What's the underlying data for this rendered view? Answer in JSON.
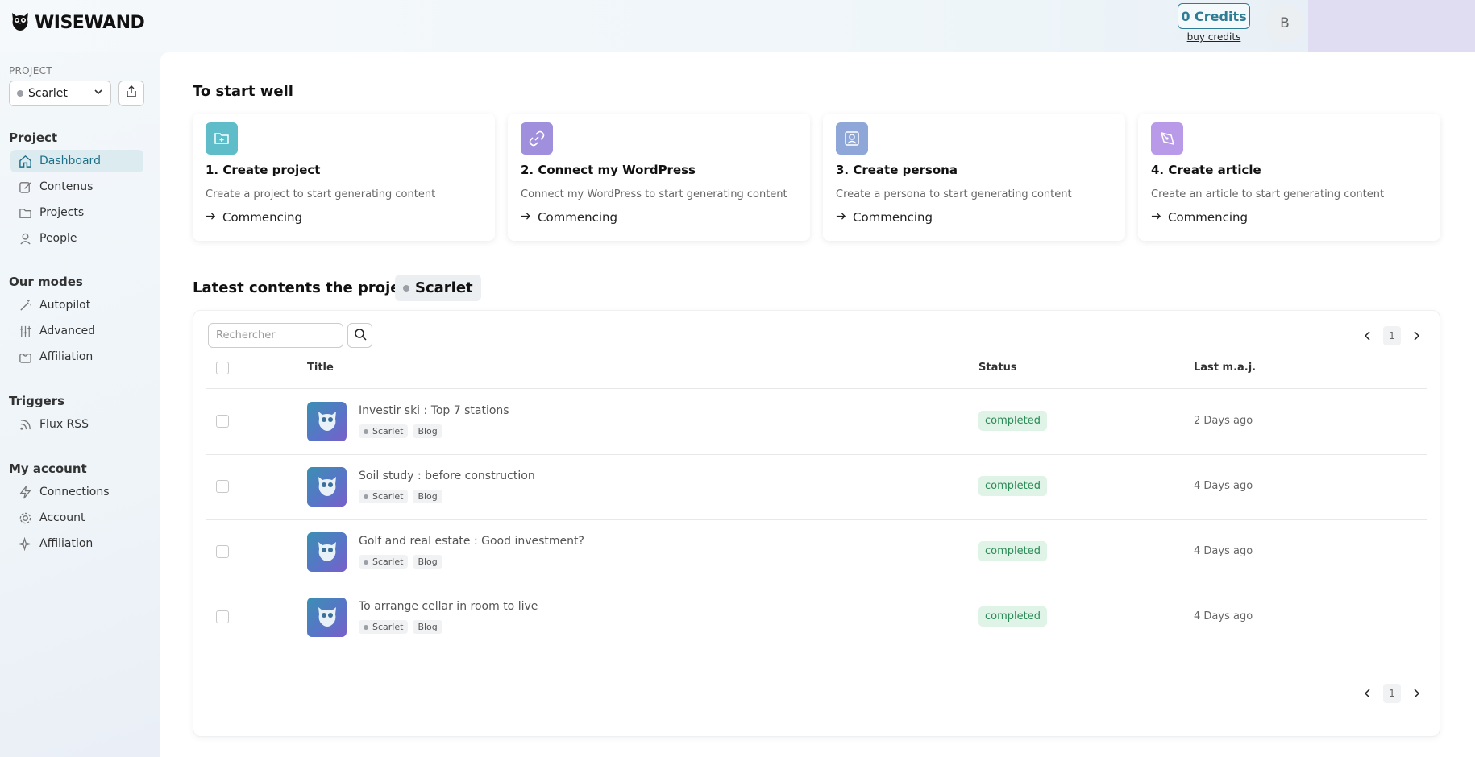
{
  "brand": {
    "name": "WISEWAND"
  },
  "header": {
    "credits": "0 Credits",
    "buy_credits": "buy credits",
    "avatar_initial": "B"
  },
  "sidebar": {
    "project_label": "PROJECT",
    "project_selected": "Scarlet",
    "sections": [
      {
        "title": "Project",
        "items": [
          {
            "label": "Dashboard",
            "icon": "home-icon",
            "active": true
          },
          {
            "label": "Contenus",
            "icon": "edit-icon"
          },
          {
            "label": "Projects",
            "icon": "folder-icon"
          },
          {
            "label": "People",
            "icon": "user-icon"
          }
        ]
      },
      {
        "title": "Our modes",
        "items": [
          {
            "label": "Autopilot",
            "icon": "wand-icon"
          },
          {
            "label": "Advanced",
            "icon": "sliders-icon"
          },
          {
            "label": "Affiliation",
            "icon": "bag-icon"
          }
        ]
      },
      {
        "title": "Triggers",
        "items": [
          {
            "label": "Flux RSS",
            "icon": "rss-icon"
          }
        ]
      },
      {
        "title": "My account",
        "items": [
          {
            "label": "Connections",
            "icon": "bolt-icon"
          },
          {
            "label": "Account",
            "icon": "gear-icon"
          },
          {
            "label": "Affiliation",
            "icon": "sparkle-icon"
          }
        ]
      }
    ]
  },
  "start": {
    "title": "To start well",
    "cards": [
      {
        "title": "1. Create project",
        "desc": "Create a project to start generating content",
        "link": "Commencing",
        "icon": "folder-plus-icon",
        "color": "#5fbcc9"
      },
      {
        "title": "2. Connect my WordPress",
        "desc": "Connect my WordPress to start generating content",
        "link": "Commencing",
        "icon": "link-icon",
        "color": "#a08fdc"
      },
      {
        "title": "3. Create persona",
        "desc": "Create a persona to start generating content",
        "link": "Commencing",
        "icon": "persona-icon",
        "color": "#8ea6d8"
      },
      {
        "title": "4. Create article",
        "desc": "Create an article to start generating content",
        "link": "Commencing",
        "icon": "pen-icon",
        "color": "#b99ae8"
      }
    ]
  },
  "latest": {
    "title": "Latest contents the project",
    "project": "Scarlet",
    "search_placeholder": "Rechercher",
    "page": "1",
    "columns": {
      "title": "Title",
      "status": "Status",
      "updated": "Last m.a.j."
    },
    "rows": [
      {
        "title": "Investir ski : Top 7 stations",
        "project": "Scarlet",
        "type": "Blog",
        "status": "completed",
        "updated": "2 Days ago"
      },
      {
        "title": "Soil study : before construction",
        "project": "Scarlet",
        "type": "Blog",
        "status": "completed",
        "updated": "4 Days ago"
      },
      {
        "title": "Golf and real estate : Good investment?",
        "project": "Scarlet",
        "type": "Blog",
        "status": "completed",
        "updated": "4 Days ago"
      },
      {
        "title": "To arrange cellar in room to live",
        "project": "Scarlet",
        "type": "Blog",
        "status": "completed",
        "updated": "4 Days ago"
      }
    ]
  }
}
